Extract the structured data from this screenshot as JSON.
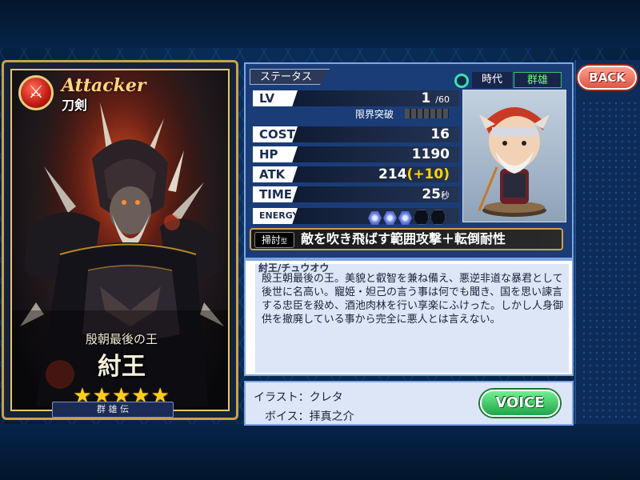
{
  "nav": {
    "back_label": "BACK"
  },
  "card": {
    "attribute_icon": "sword-icon",
    "role": "Attacker",
    "weapon": "刀剣",
    "epithet": "殷朝最後の王",
    "name": "紂王",
    "rarity_stars": 5,
    "stars_text": "★★★★★",
    "series": "群 雄 伝"
  },
  "status": {
    "tab_label": "ステータス",
    "era_label": "時代",
    "era_value": "群雄",
    "lv_label": "LV",
    "lv_value": "1",
    "lv_max": "/60",
    "limit_break_label": "限界突破",
    "cost_label": "COST",
    "cost_value": "16",
    "hp_label": "HP",
    "hp_value": "1190",
    "atk_label": "ATK",
    "atk_value": "214",
    "atk_bonus": "(+10)",
    "time_label": "TIME",
    "time_value": "25",
    "time_unit": "秒",
    "energy_label": "ENERGY",
    "energy_filled": 3,
    "energy_total": 5
  },
  "skill": {
    "type": "掃討",
    "type_suffix": "型",
    "name": "敵を吹き飛ばす範囲攻撃＋転倒耐性"
  },
  "description": {
    "cut_line": "紂王/チュウオウ",
    "text": "殷王朝最後の王。美貌と叡智を兼ね備え、悪逆非道な暴君として後世に名高い。寵姫・妲己の言う事は何でも聞き、国を思い諫言する忠臣を殺め、酒池肉林を行い享楽にふけった。しかし人身御供を撤廃している事から完全に悪人とは言えない。"
  },
  "credits": {
    "illust": "イラスト：クレタ",
    "voice": "ボイス：拝真之介"
  },
  "voice_button": "VOICE",
  "colors": {
    "gold_frame": "#c9a24a",
    "panel_blue": "#1a3d78",
    "voice_green": "#1ea54a",
    "back_red": "#e05544",
    "bonus_yellow": "#ffd400"
  }
}
